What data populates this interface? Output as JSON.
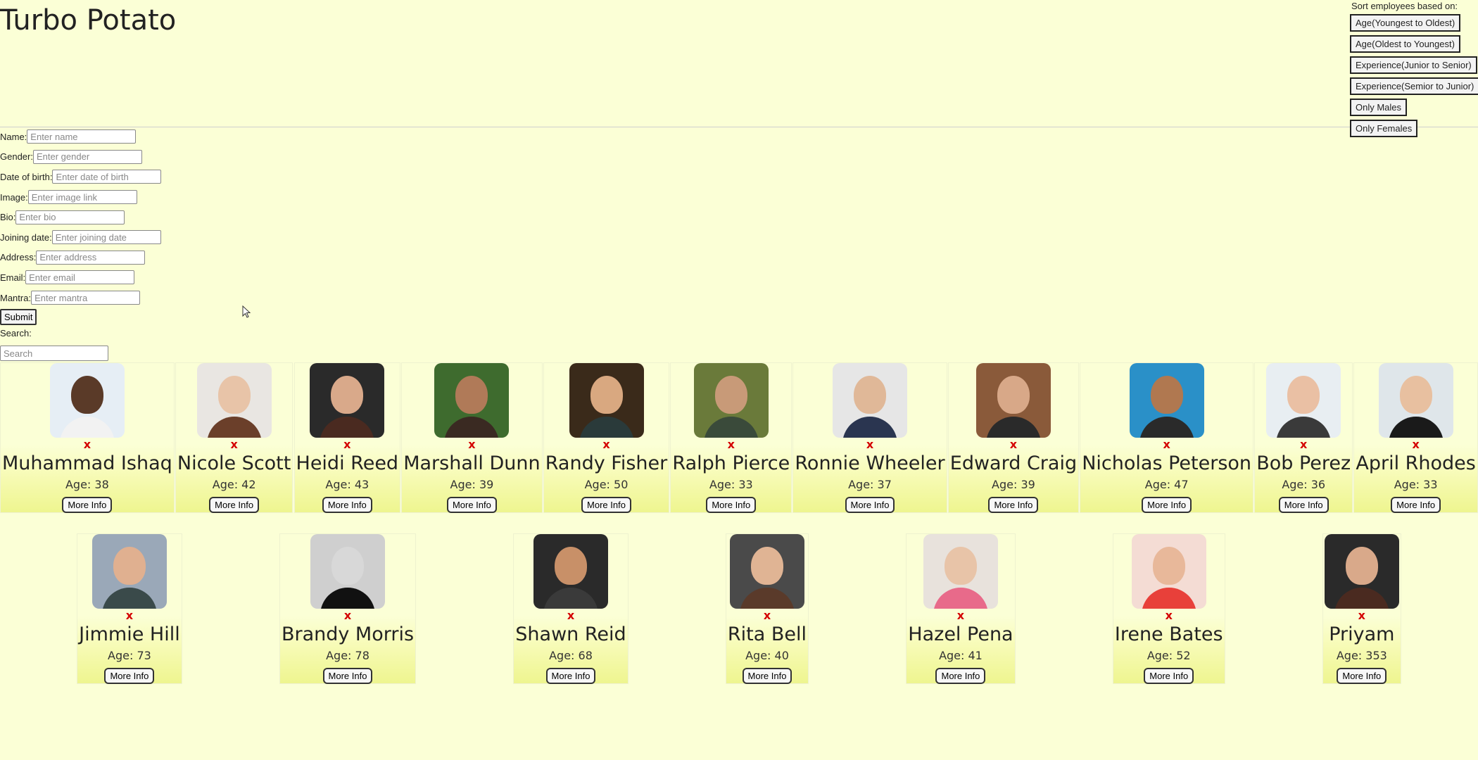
{
  "app": {
    "title": "Turbo Potato"
  },
  "sort": {
    "title": "Sort employees based on:",
    "options": [
      "Age(Youngest to Oldest)",
      "Age(Oldest to Youngest)",
      "Experience(Junior to Senior)",
      "Experience(Semior to Junior)",
      "Only Males",
      "Only Females"
    ]
  },
  "form": {
    "fields": [
      {
        "label": "Name:",
        "placeholder": "Enter name"
      },
      {
        "label": "Gender:",
        "placeholder": "Enter gender"
      },
      {
        "label": "Date of birth:",
        "placeholder": "Enter date of birth"
      },
      {
        "label": "Image:",
        "placeholder": "Enter image link"
      },
      {
        "label": "Bio:",
        "placeholder": "Enter bio"
      },
      {
        "label": "Joining date:",
        "placeholder": "Enter joining date"
      },
      {
        "label": "Address:",
        "placeholder": "Enter address"
      },
      {
        "label": "Email:",
        "placeholder": "Enter email"
      },
      {
        "label": "Mantra:",
        "placeholder": "Enter mantra"
      }
    ],
    "submit_label": "Submit"
  },
  "search": {
    "label": "Search:",
    "placeholder": "Search"
  },
  "card_labels": {
    "remove": "x",
    "more_info": "More Info",
    "age_prefix": "Age: "
  },
  "employees": [
    {
      "name": "Muhammad Ishaq",
      "age": "38",
      "bg": "#e6eef5",
      "skin": "#5a3a28",
      "shirt": "#f2f2f2"
    },
    {
      "name": "Nicole Scott",
      "age": "42",
      "bg": "#e9e6e2",
      "skin": "#e8c4a8",
      "shirt": "#6b3f2a"
    },
    {
      "name": "Heidi Reed",
      "age": "43",
      "bg": "#2a2a2a",
      "skin": "#d9a98a",
      "shirt": "#4a2a20"
    },
    {
      "name": "Marshall Dunn",
      "age": "39",
      "bg": "#3e6b2e",
      "skin": "#b07a58",
      "shirt": "#3a2a22"
    },
    {
      "name": "Randy Fisher",
      "age": "50",
      "bg": "#3a2a1a",
      "skin": "#d9a880",
      "shirt": "#2a3a3a"
    },
    {
      "name": "Ralph Pierce",
      "age": "33",
      "bg": "#6a7a3a",
      "skin": "#c89a78",
      "shirt": "#3a4a3a"
    },
    {
      "name": "Ronnie Wheeler",
      "age": "37",
      "bg": "#e6e6e6",
      "skin": "#e0b898",
      "shirt": "#2a3550"
    },
    {
      "name": "Edward Craig",
      "age": "39",
      "bg": "#8a5a3a",
      "skin": "#d8a888",
      "shirt": "#2a2a2a"
    },
    {
      "name": "Nicholas Peterson",
      "age": "47",
      "bg": "#2a90c8",
      "skin": "#b07850",
      "shirt": "#2a2a2a"
    },
    {
      "name": "Bob Perez",
      "age": "36",
      "bg": "#e8eef2",
      "skin": "#eac0a4",
      "shirt": "#3a3a3a"
    },
    {
      "name": "April Rhodes",
      "age": "33",
      "bg": "#dfe6ea",
      "skin": "#e8c0a0",
      "shirt": "#1a1a1a"
    },
    {
      "name": "Jimmie Hill",
      "age": "73",
      "bg": "#9aa8b8",
      "skin": "#e0b090",
      "shirt": "#3a4a4a"
    },
    {
      "name": "Brandy Morris",
      "age": "78",
      "bg": "#cfcfcf",
      "skin": "#d8d8d8",
      "shirt": "#111111"
    },
    {
      "name": "Shawn Reid",
      "age": "68",
      "bg": "#2a2a2a",
      "skin": "#c89068",
      "shirt": "#3a3a3a"
    },
    {
      "name": "Rita Bell",
      "age": "40",
      "bg": "#4a4a4a",
      "skin": "#e0b494",
      "shirt": "#5a3a2a"
    },
    {
      "name": "Hazel Pena",
      "age": "41",
      "bg": "#e8e2dc",
      "skin": "#e8c4a8",
      "shirt": "#e86a8a"
    },
    {
      "name": "Irene Bates",
      "age": "52",
      "bg": "#f4dcd4",
      "skin": "#e8b89a",
      "shirt": "#e8403a"
    },
    {
      "name": "Priyam",
      "age": "353",
      "bg": "#2a2a2a",
      "skin": "#d9a98a",
      "shirt": "#4a2a20"
    }
  ],
  "colors": {
    "page_bg": "#fbffd6",
    "remove_x": "#d40000",
    "card_gradient_bottom": "#eef58f"
  }
}
